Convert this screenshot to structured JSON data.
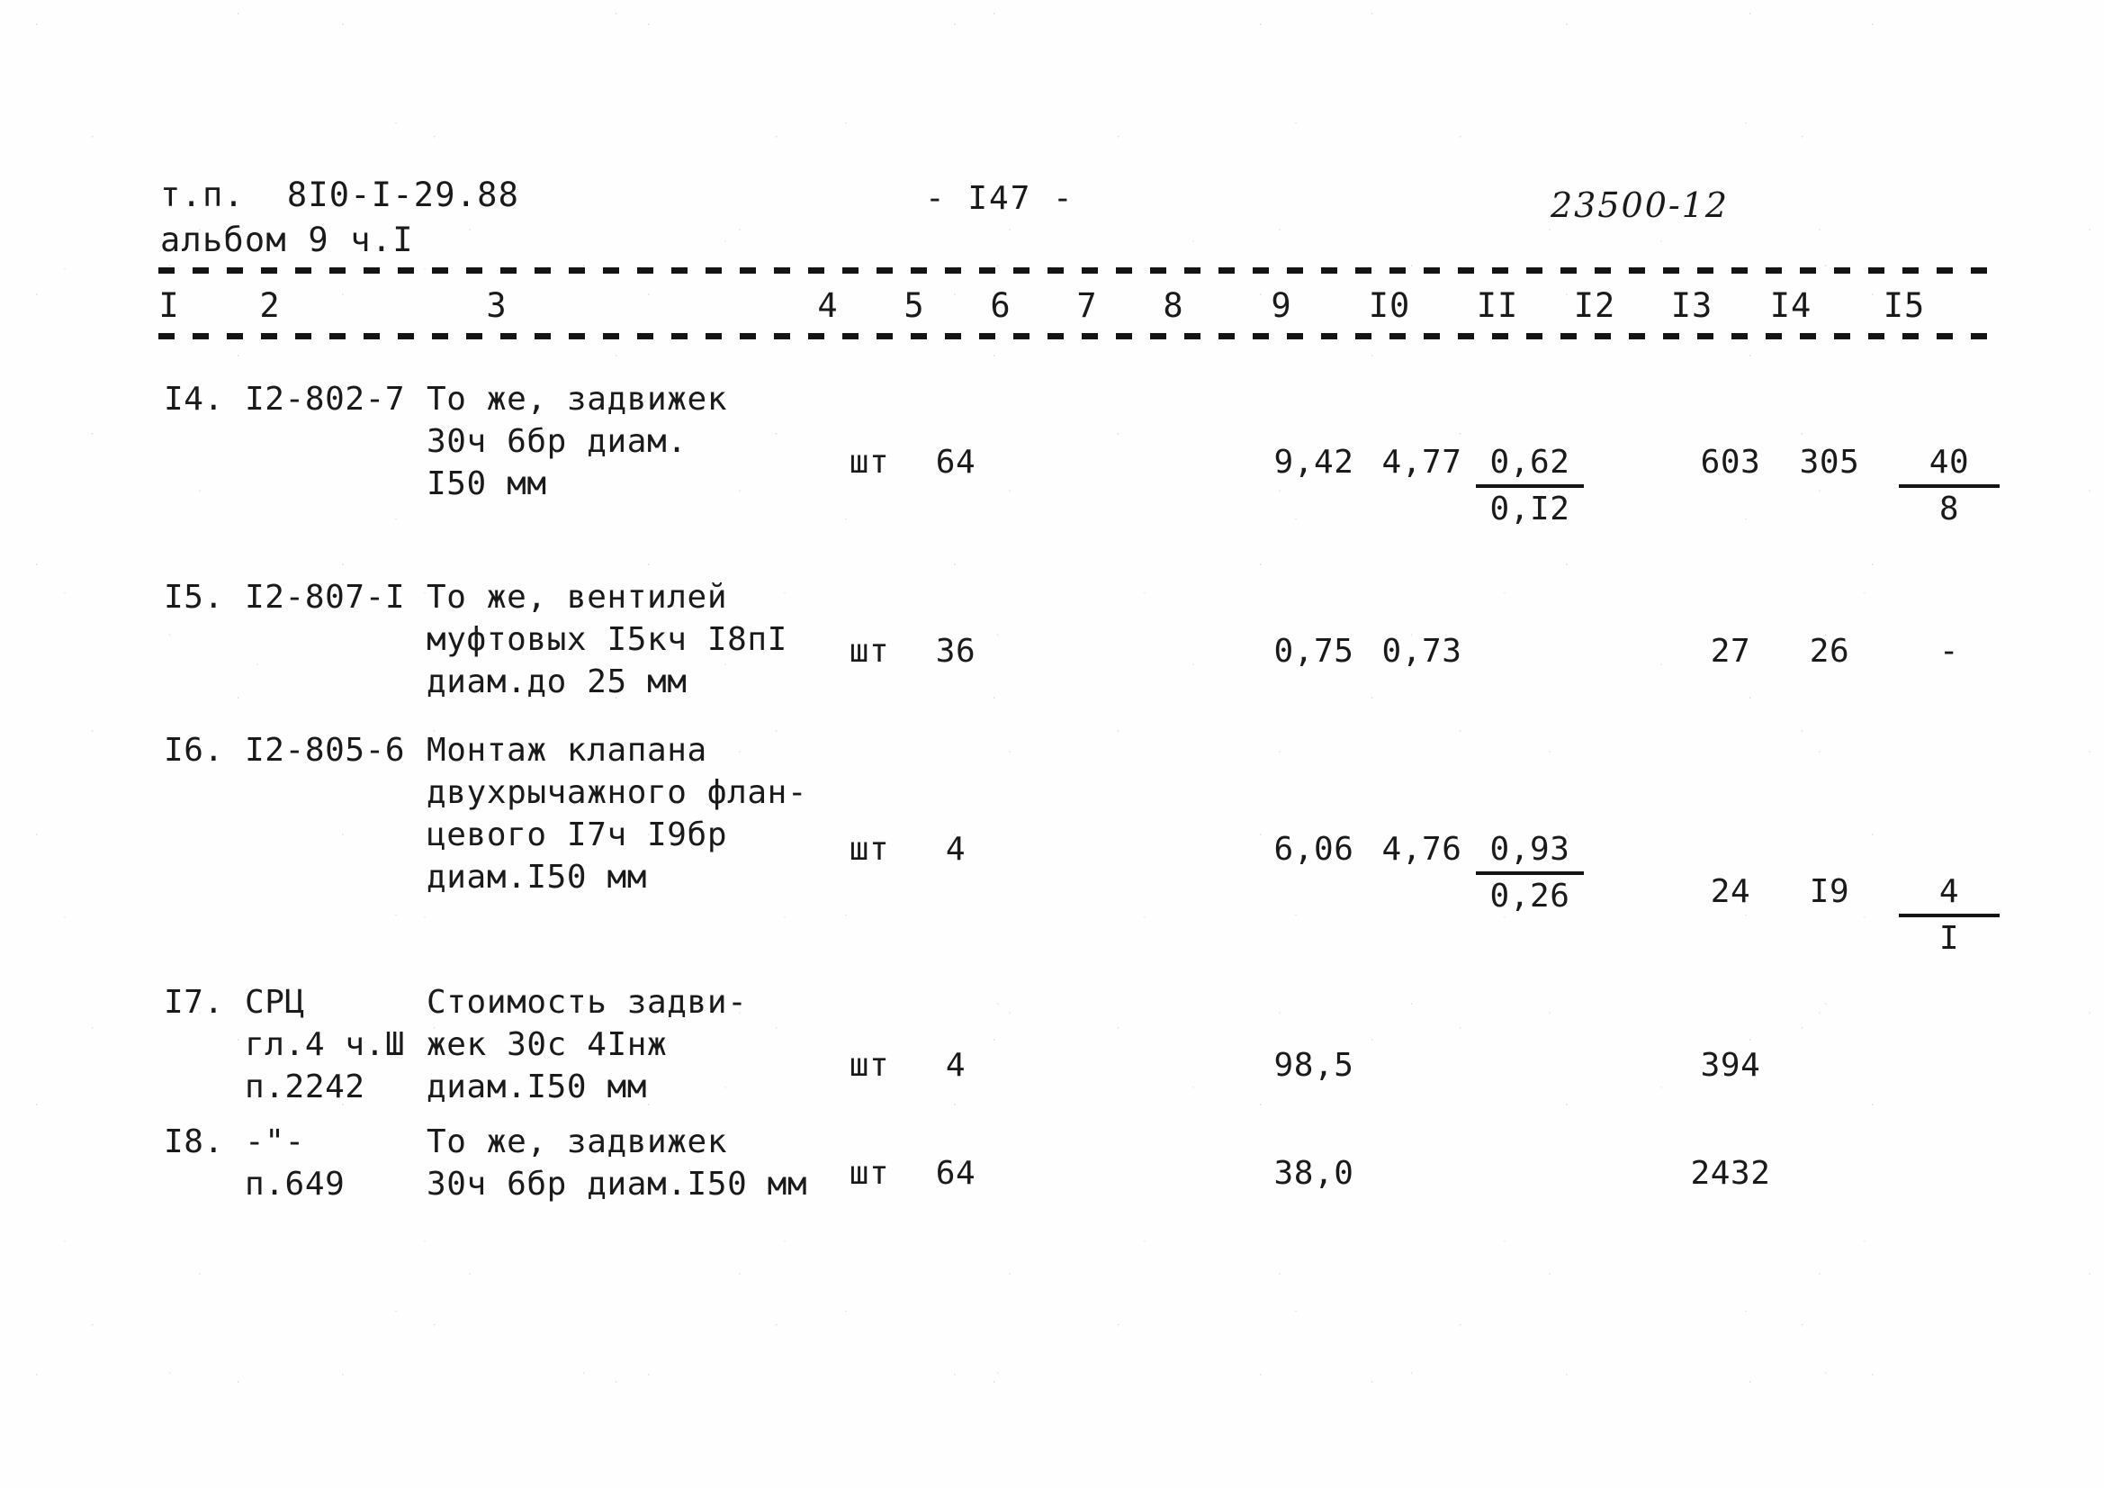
{
  "document": {
    "project_code_label": "т.п.",
    "project_code": "8I0-I-29.88",
    "album": "альбом 9 ч.I",
    "page_marker": "- I47 -",
    "sheet_code": "23500-12"
  },
  "table": {
    "column_headers": [
      "I",
      "2",
      "3",
      "4",
      "5",
      "6",
      "7",
      "8",
      "9",
      "I0",
      "II",
      "I2",
      "I3",
      "I4",
      "I5"
    ],
    "rows": [
      {
        "num": "I4.",
        "code": "I2-802-7",
        "desc": "То же, задвижек\n30ч 6бр диам.\nI50 мм",
        "unit": "шт",
        "qty": "64",
        "c6": "",
        "c7": "",
        "c8": "",
        "c9": "9,42",
        "c10": "4,77",
        "c11_top": "0,62",
        "c11_bot": "0,I2",
        "c12": "",
        "c13": "603",
        "c14": "305",
        "c15_top": "40",
        "c15_bot": "8"
      },
      {
        "num": "I5.",
        "code": "I2-807-I",
        "desc": "То же, вентилей\nмуфтовых I5кч I8пI\nдиам.до 25 мм",
        "unit": "шт",
        "qty": "36",
        "c6": "",
        "c7": "",
        "c8": "",
        "c9": "0,75",
        "c10": "0,73",
        "c11_top": "",
        "c11_bot": "",
        "c12": "",
        "c13": "27",
        "c14": "26",
        "c15_top": "-",
        "c15_bot": ""
      },
      {
        "num": "I6.",
        "code": "I2-805-6",
        "desc": "Монтаж клапана\nдвухрычажного флан-\nцевого I7ч I9бр\nдиам.I50 мм",
        "unit": "шт",
        "qty": "4",
        "c6": "",
        "c7": "",
        "c8": "",
        "c9": "6,06",
        "c10": "4,76",
        "c11_top": "0,93",
        "c11_bot": "0,26",
        "c12": "",
        "c13": "24",
        "c14": "I9",
        "c15_top": "4",
        "c15_bot": "I"
      },
      {
        "num": "I7.",
        "code": "СРЦ\nгл.4 ч.Ш\nп.2242",
        "desc": "Стоимость задви-\nжек 30с 4Iнж\nдиам.I50 мм",
        "unit": "шт",
        "qty": "4",
        "c6": "",
        "c7": "",
        "c8": "",
        "c9": "98,5",
        "c10": "",
        "c11_top": "",
        "c11_bot": "",
        "c12": "",
        "c13": "394",
        "c14": "",
        "c15_top": "",
        "c15_bot": ""
      },
      {
        "num": "I8.",
        "code": "-\"-\nп.649",
        "desc": "То же, задвижек\n30ч 6бр диам.I50 мм",
        "unit": "шт",
        "qty": "64",
        "c6": "",
        "c7": "",
        "c8": "",
        "c9": "38,0",
        "c10": "",
        "c11_top": "",
        "c11_bot": "",
        "c12": "",
        "c13": "2432",
        "c14": "",
        "c15_top": "",
        "c15_bot": ""
      }
    ]
  },
  "layout": {
    "column_header_x": [
      188,
      300,
      552,
      920,
      1016,
      1112,
      1208,
      1304,
      1424,
      1544,
      1664,
      1772,
      1880,
      1990,
      2116
    ],
    "row_tops": [
      420,
      640,
      810,
      1090,
      1245
    ],
    "value_tops": [
      490,
      700,
      920,
      1160,
      1280
    ]
  }
}
